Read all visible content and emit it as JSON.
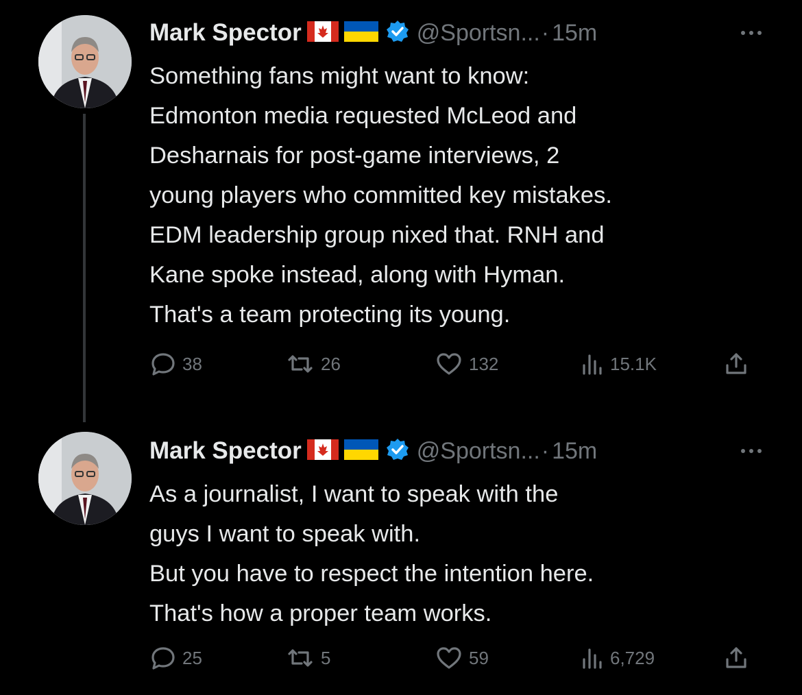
{
  "colors": {
    "background": "#000000",
    "text_primary": "#e7e9ea",
    "text_secondary": "#71767b",
    "verified_badge": "#1d9bf0",
    "canada_flag_red": "#d52b1e",
    "ukraine_flag_blue": "#0057b7",
    "ukraine_flag_yellow": "#ffd700"
  },
  "tweets": [
    {
      "author_name": "Mark Spector",
      "flags": [
        "canada-flag",
        "ukraine-flag"
      ],
      "verified": true,
      "handle": "@Sportsn...",
      "separator": "·",
      "time": "15m",
      "text_lines": [
        "Something fans might want to know:",
        "Edmonton media requested McLeod and",
        "Desharnais for post-game interviews, 2",
        "young players who committed key mistakes.",
        "EDM leadership group nixed that. RNH and",
        "Kane spoke instead, along with Hyman.",
        "That's a team protecting its young."
      ],
      "stats": {
        "replies": "38",
        "retweets": "26",
        "likes": "132",
        "views": "15.1K"
      }
    },
    {
      "author_name": "Mark Spector",
      "flags": [
        "canada-flag",
        "ukraine-flag"
      ],
      "verified": true,
      "handle": "@Sportsn...",
      "separator": "·",
      "time": "15m",
      "text_lines": [
        "As a journalist, I want to speak with the",
        "guys I want to speak with.",
        "But you have to respect the intention here.",
        "That's how a proper team works."
      ],
      "stats": {
        "replies": "25",
        "retweets": "5",
        "likes": "59",
        "views": "6,729"
      }
    }
  ]
}
